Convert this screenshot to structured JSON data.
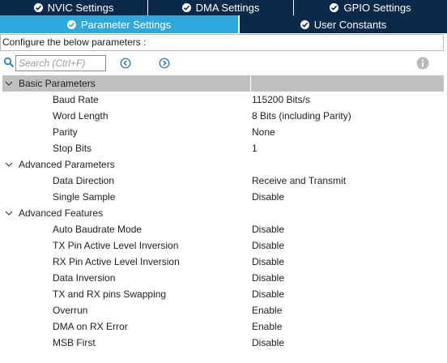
{
  "tabs_row1": [
    {
      "label": "NVIC Settings"
    },
    {
      "label": "DMA Settings"
    },
    {
      "label": "GPIO Settings"
    }
  ],
  "tabs_row2": [
    {
      "label": "Parameter Settings",
      "active": true
    },
    {
      "label": "User Constants",
      "active": false
    }
  ],
  "configure_text": "Configure the below parameters :",
  "search": {
    "placeholder": "Search (Ctrl+F)"
  },
  "groups": [
    {
      "label": "Basic Parameters",
      "params": [
        {
          "name": "Baud Rate",
          "value": "115200 Bits/s"
        },
        {
          "name": "Word Length",
          "value": "8 Bits (including Parity)"
        },
        {
          "name": "Parity",
          "value": "None"
        },
        {
          "name": "Stop Bits",
          "value": "1"
        }
      ]
    },
    {
      "label": "Advanced Parameters",
      "params": [
        {
          "name": "Data Direction",
          "value": "Receive and Transmit"
        },
        {
          "name": "Single Sample",
          "value": "Disable"
        }
      ]
    },
    {
      "label": "Advanced Features",
      "params": [
        {
          "name": "Auto Baudrate Mode",
          "value": "Disable"
        },
        {
          "name": "TX Pin Active Level Inversion",
          "value": "Disable"
        },
        {
          "name": "RX Pin Active Level Inversion",
          "value": "Disable"
        },
        {
          "name": "Data Inversion",
          "value": "Disable"
        },
        {
          "name": "TX and RX pins Swapping",
          "value": "Disable"
        },
        {
          "name": "Overrun",
          "value": "Enable"
        },
        {
          "name": "DMA on RX Error",
          "value": "Enable"
        },
        {
          "name": "MSB First",
          "value": "Disable"
        }
      ]
    }
  ],
  "colors": {
    "tab_dark": "#0b2a4a",
    "tab_active": "#2ea7db",
    "selection": "#bfbfbf"
  }
}
